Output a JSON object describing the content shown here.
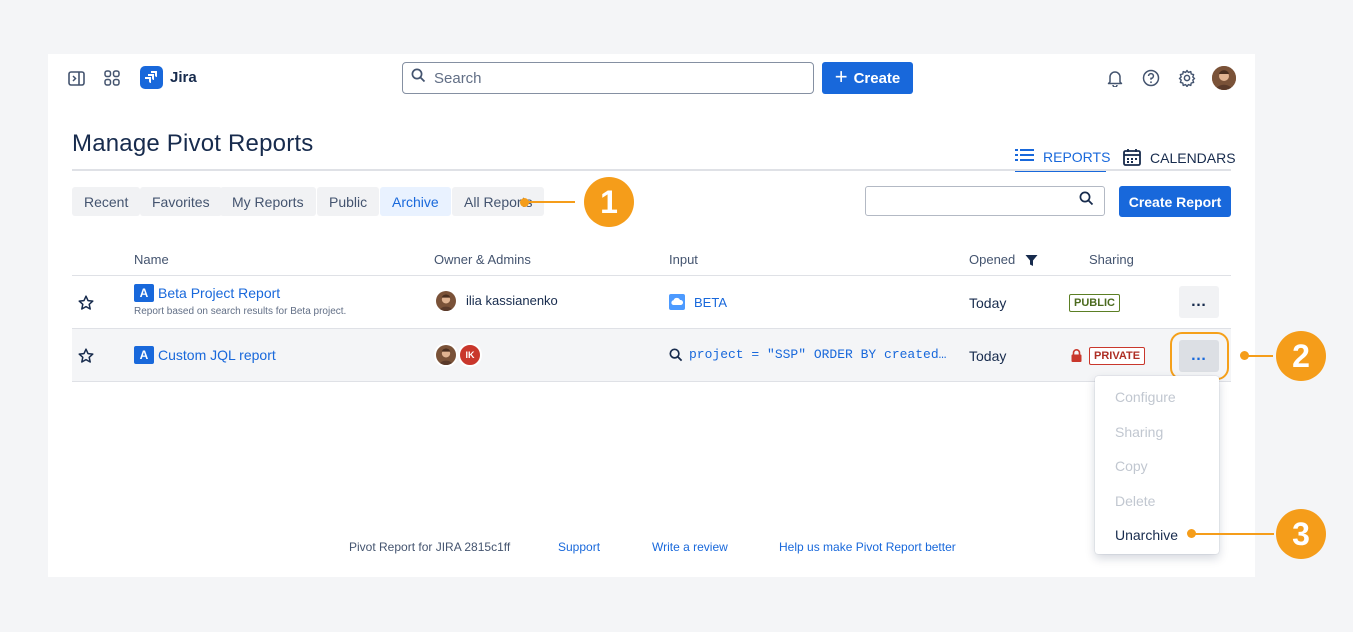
{
  "nav": {
    "app_name": "Jira",
    "search_placeholder": "Search",
    "create_label": "Create"
  },
  "page": {
    "title": "Manage Pivot Reports",
    "view_tabs": [
      {
        "label": "REPORTS",
        "icon": "list-icon",
        "active": true
      },
      {
        "label": "CALENDARS",
        "icon": "calendar-icon",
        "active": false
      }
    ]
  },
  "filters": {
    "tabs": [
      "Recent",
      "Favorites",
      "My Reports",
      "Public",
      "Archive",
      "All Reports"
    ],
    "active": "Archive",
    "create_report_label": "Create Report"
  },
  "table": {
    "headers": {
      "name": "Name",
      "owner": "Owner & Admins",
      "input": "Input",
      "opened": "Opened",
      "sharing": "Sharing"
    },
    "rows": [
      {
        "type_badge": "A",
        "name": "Beta Project Report",
        "description": "Report based on search results for Beta project.",
        "owner": "ilia kassianenko",
        "input": "BETA",
        "opened": "Today",
        "sharing": "PUBLIC"
      },
      {
        "type_badge": "A",
        "name": "Custom JQL report",
        "owner_initials": "IK",
        "input": "project = \"SSP\" ORDER BY created…",
        "opened": "Today",
        "sharing": "PRIVATE"
      }
    ],
    "more_label": "…"
  },
  "menu": {
    "items": [
      {
        "label": "Configure",
        "enabled": false
      },
      {
        "label": "Sharing",
        "enabled": false
      },
      {
        "label": "Copy",
        "enabled": false
      },
      {
        "label": "Delete",
        "enabled": false
      },
      {
        "label": "Unarchive",
        "enabled": true
      }
    ]
  },
  "footer": {
    "version": "Pivot Report for JIRA 2815c1ff",
    "support": "Support",
    "review": "Write a review",
    "feedback": "Help us make Pivot Report better"
  },
  "callouts": [
    "1",
    "2",
    "3"
  ],
  "colors": {
    "brand_blue": "#1868db",
    "callout_orange": "#f59d1a",
    "public_green": "#4c6b1f",
    "private_red": "#ae2e24"
  }
}
